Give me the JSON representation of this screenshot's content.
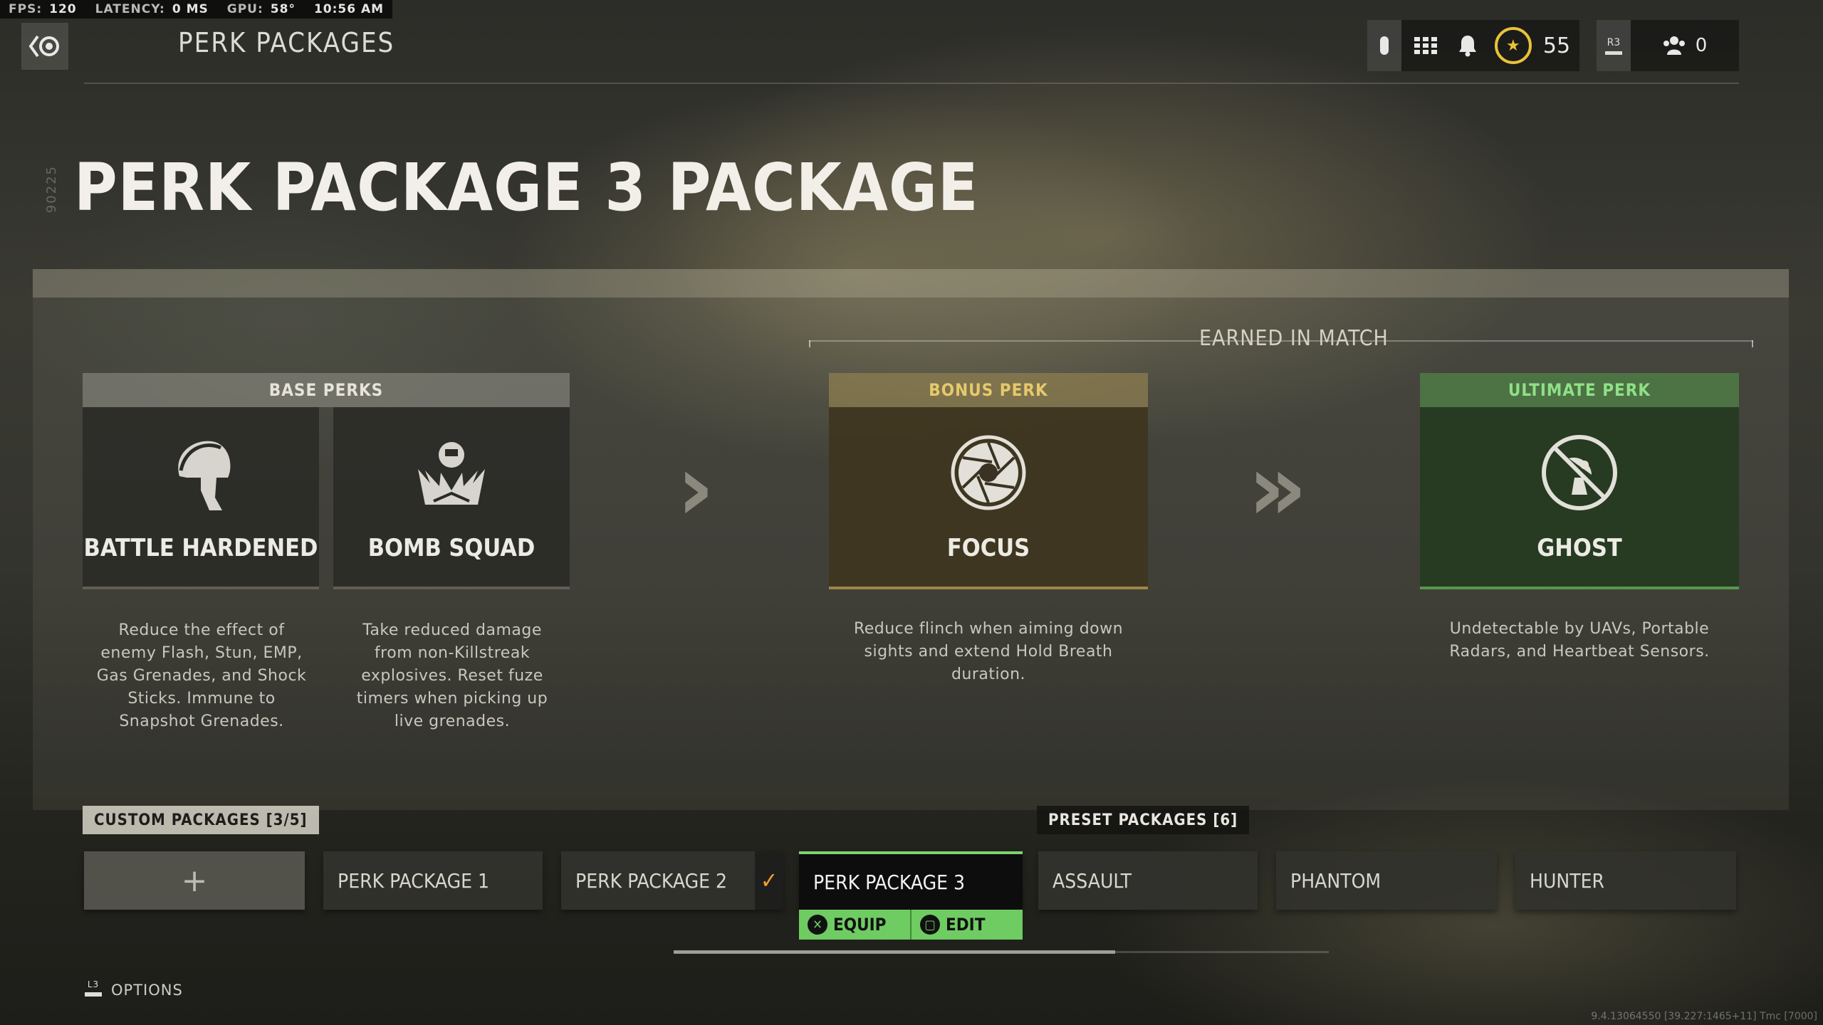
{
  "stats": {
    "fps_label": "FPS:",
    "fps_value": "120",
    "latency_label": "LATENCY:",
    "latency_value": "0 MS",
    "gpu_label": "GPU:",
    "gpu_value": "58°",
    "time": "10:56 AM"
  },
  "header": {
    "title": "PERK PACKAGES",
    "currency": "55",
    "r3_label": "R3",
    "friends_count": "0"
  },
  "side_code": "90225",
  "page_heading": "PERK PACKAGE 3 PACKAGE",
  "earned_label": "EARNED IN MATCH",
  "base": {
    "header": "BASE PERKS",
    "perks": [
      {
        "name": "BATTLE HARDENED",
        "icon": "spartan-helmet-icon",
        "description": "Reduce the effect of enemy Flash, Stun, EMP, Gas Grenades, and Shock Sticks. Immune to Snapshot Grenades."
      },
      {
        "name": "BOMB SQUAD",
        "icon": "bomb-squad-icon",
        "description": "Take reduced damage from non-Killstreak explosives. Reset fuze timers when picking up live grenades."
      }
    ]
  },
  "bonus": {
    "header": "BONUS PERK",
    "name": "FOCUS",
    "icon": "aperture-icon",
    "description": "Reduce flinch when aiming down sights and extend Hold Breath duration.",
    "color": "#e6c96b"
  },
  "ultimate": {
    "header": "ULTIMATE PERK",
    "name": "GHOST",
    "icon": "no-radar-icon",
    "description": "Undetectable by UAVs, Portable Radars, and Heartbeat Sensors.",
    "color": "#7fd47a"
  },
  "packages": {
    "custom_label": "CUSTOM PACKAGES [3/5]",
    "preset_label": "PRESET PACKAGES [6]",
    "add_symbol": "+",
    "custom": [
      "PERK PACKAGE 1",
      "PERK PACKAGE 2",
      "PERK PACKAGE 3"
    ],
    "preset": [
      "ASSAULT",
      "PHANTOM",
      "HUNTER"
    ],
    "equipped_check": "✓",
    "selected_index": 2,
    "equip_label": "EQUIP",
    "edit_label": "EDIT",
    "accent": "#6fcc62"
  },
  "footer": {
    "options_label": "OPTIONS",
    "l3_label": "L3",
    "version": "9.4.13064550 [39.227:1465+11] Tmc [7000]"
  }
}
